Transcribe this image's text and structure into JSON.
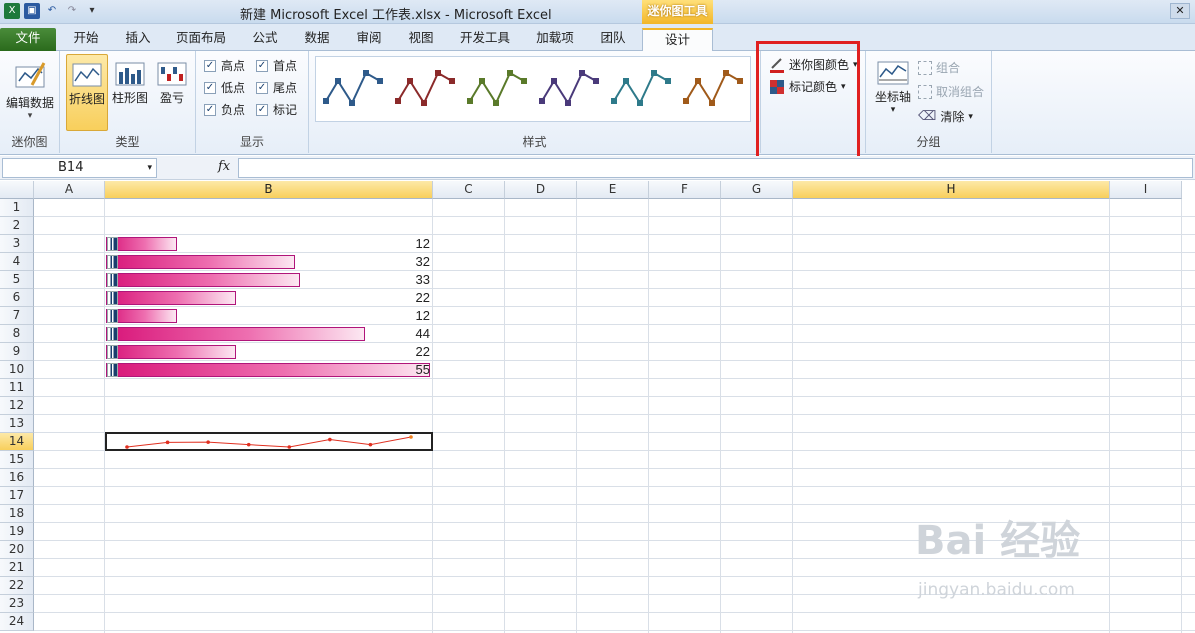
{
  "title_bar": {
    "document_title": "新建 Microsoft Excel 工作表.xlsx  -  Microsoft Excel",
    "context_tab": "迷你图工具"
  },
  "tabs": [
    "文件",
    "开始",
    "插入",
    "页面布局",
    "公式",
    "数据",
    "审阅",
    "视图",
    "开发工具",
    "加载项",
    "团队",
    "设计"
  ],
  "active_tab": "设计",
  "ribbon": {
    "edit_data": "编辑数据",
    "group_sparkline": "迷你图",
    "type_line": "折线图",
    "type_column": "柱形图",
    "type_winloss": "盈亏",
    "group_type": "类型",
    "show": [
      {
        "label": "高点",
        "checked": true
      },
      {
        "label": "首点",
        "checked": true
      },
      {
        "label": "低点",
        "checked": true
      },
      {
        "label": "尾点",
        "checked": true
      },
      {
        "label": "负点",
        "checked": true
      },
      {
        "label": "标记",
        "checked": true
      }
    ],
    "group_show": "显示",
    "group_style": "样式",
    "sparkline_color": "迷你图颜色",
    "marker_color": "标记颜色",
    "axis": "坐标轴",
    "group_btn": "组合",
    "ungroup_btn": "取消组合",
    "clear_btn": "清除",
    "group_group": "分组",
    "style_colors": [
      "#2e5a8a",
      "#8b2a2a",
      "#5a7a2a",
      "#4a3a7a",
      "#2e7a8a",
      "#a05a1a"
    ]
  },
  "formula_bar": {
    "name_box": "B14",
    "fx": "fx",
    "formula": ""
  },
  "columns": [
    "A",
    "B",
    "C",
    "D",
    "E",
    "F",
    "G",
    "H",
    "I"
  ],
  "rows": [
    "1",
    "2",
    "3",
    "4",
    "5",
    "6",
    "7",
    "8",
    "9",
    "10",
    "11",
    "12",
    "13",
    "14",
    "15",
    "16",
    "17",
    "18",
    "19",
    "20",
    "21",
    "22",
    "23",
    "24"
  ],
  "selected_cell": {
    "col": "B",
    "row": "14"
  },
  "data_values": [
    {
      "row": "3",
      "value": 12
    },
    {
      "row": "4",
      "value": 32
    },
    {
      "row": "5",
      "value": 33
    },
    {
      "row": "6",
      "value": 22
    },
    {
      "row": "7",
      "value": 12
    },
    {
      "row": "8",
      "value": 44
    },
    {
      "row": "9",
      "value": 22
    },
    {
      "row": "10",
      "value": 55
    }
  ],
  "watermark": {
    "brand": "Bai 经验",
    "url": "jingyan.baidu.com"
  }
}
